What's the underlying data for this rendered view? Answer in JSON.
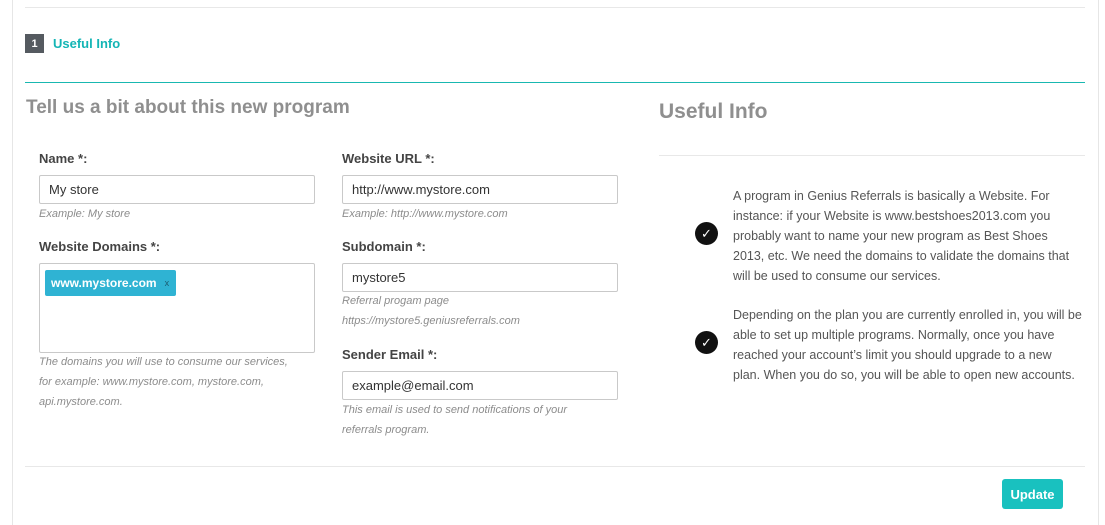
{
  "step": {
    "number": "1",
    "label": "Useful Info"
  },
  "form": {
    "title": "Tell us a bit about this new program",
    "name": {
      "label": "Name *:",
      "value": "My store",
      "help": "Example: My store"
    },
    "website_url": {
      "label": "Website URL *:",
      "value": "http://www.mystore.com",
      "help": "Example: http://www.mystore.com"
    },
    "website_domains": {
      "label": "Website Domains *:",
      "tags": [
        {
          "text": "www.mystore.com",
          "remove": "x"
        }
      ],
      "help_lines": [
        "The domains you will use to consume our services,",
        "for example: www.mystore.com, mystore.com,",
        "api.mystore.com."
      ]
    },
    "subdomain": {
      "label": "Subdomain *:",
      "value": "mystore5",
      "help_lines": [
        "Referral progam page",
        "https://mystore5.geniusreferrals.com"
      ]
    },
    "sender_email": {
      "label": "Sender Email *:",
      "value": "example@email.com",
      "help_lines": [
        "This email is used to send notifications of your",
        "referrals program."
      ]
    }
  },
  "info": {
    "title": "Useful Info",
    "items": [
      {
        "icon": "check-circle-icon",
        "lines": [
          "A program in Genius Referrals is basically a Website. For",
          "instance: if your Website is www.bestshoes2013.com you",
          "probably want to name your new program as Best Shoes",
          "2013, etc. We need the domains to validate the domains that",
          "will be used to consume our services."
        ]
      },
      {
        "icon": "check-circle-icon",
        "lines": [
          "Depending on the plan you are currently enrolled in, you will be",
          "able to set up multiple programs. Normally, once you have",
          "reached your account’s limit you should upgrade to a new",
          "plan. When you do so, you will be able to open new accounts."
        ]
      }
    ]
  },
  "actions": {
    "update_label": "Update"
  },
  "colors": {
    "accent": "#19b8b1",
    "button": "#19c1bf",
    "tag": "#2fb3d3"
  }
}
